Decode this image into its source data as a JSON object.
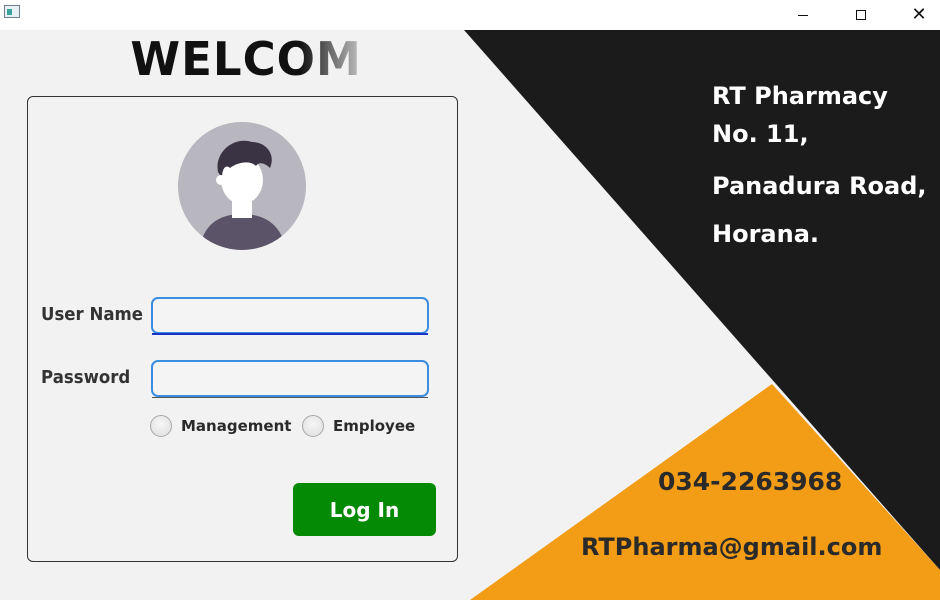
{
  "window": {
    "title": "",
    "minimize_glyph": "",
    "close_glyph": "✕",
    "icon": "app-window-icon"
  },
  "colors": {
    "background": "#f2f2f2",
    "dark_panel": "#1b1b1b",
    "orange_panel": "#f39c16",
    "login_button": "#058a06",
    "input_border": "#3a8de0"
  },
  "login": {
    "welcome": "WELCOME!",
    "avatar_icon": "user-avatar-icon",
    "username_label": "User Name",
    "username_value": "",
    "password_label": "Password",
    "password_value": "",
    "role_options": [
      "Management",
      "Employee"
    ],
    "selected_role": null,
    "login_button": "Log In"
  },
  "info": {
    "name": "RT Pharmacy",
    "address_line1": "No. 11,",
    "address_line2": "Panadura Road,",
    "city": "Horana.",
    "phone": "034-2263968",
    "email": "RTPharma@gmail.com"
  }
}
